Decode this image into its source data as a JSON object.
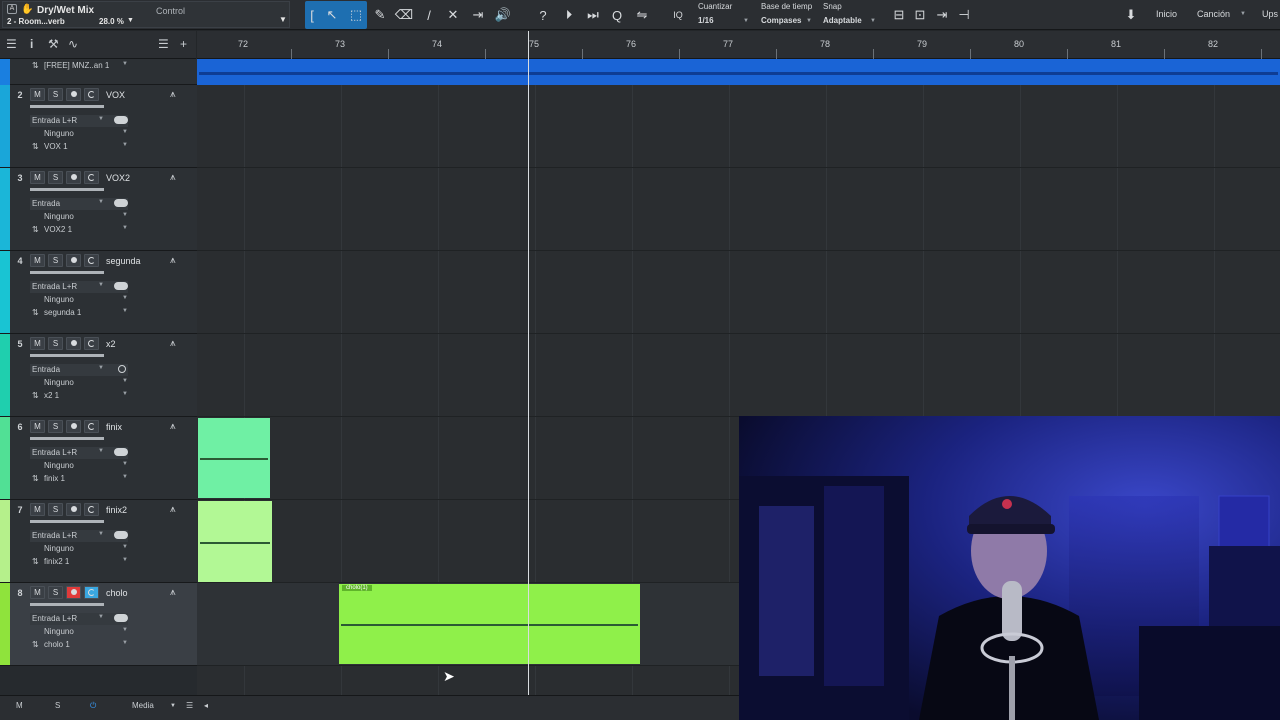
{
  "plugin": {
    "title": "Dry/Wet Mix",
    "preset": "2 - Room...verb",
    "percent": "28.0 %",
    "control": "Control"
  },
  "toolbar": {
    "quantize_label": "Cuantizar",
    "quantize_value": "1/16",
    "timebase_label": "Base de tiemp",
    "timebase_value": "Compases",
    "snap_label": "Snap",
    "snap_value": "Adaptable",
    "start": "Inicio",
    "song": "Canción",
    "upgrade": "Ups"
  },
  "ruler": {
    "bars": [
      "72",
      "73",
      "74",
      "75",
      "76",
      "77",
      "78",
      "79",
      "80",
      "81",
      "82"
    ]
  },
  "first_track": {
    "name": "[FREE] MNZ..an 1"
  },
  "tracks": [
    {
      "num": "2",
      "name": "VOX",
      "input": "Entrada L+R",
      "output": "Ninguno",
      "playlist": "VOX 1",
      "color": "#1aa6d9"
    },
    {
      "num": "3",
      "name": "VOX2",
      "input": "Entrada",
      "output": "Ninguno",
      "playlist": "VOX2 1",
      "color": "#1bb6d8"
    },
    {
      "num": "4",
      "name": "segunda",
      "input": "Entrada L+R",
      "output": "Ninguno",
      "playlist": "segunda 1",
      "color": "#19c4d3"
    },
    {
      "num": "5",
      "name": "x2",
      "input": "Entrada",
      "output": "Ninguno",
      "playlist": "x2 1",
      "color": "#1fcfae"
    },
    {
      "num": "6",
      "name": "finix",
      "input": "Entrada L+R",
      "output": "Ninguno",
      "playlist": "finix 1",
      "color": "#51e095"
    },
    {
      "num": "7",
      "name": "finix2",
      "input": "Entrada L+R",
      "output": "Ninguno",
      "playlist": "finix2 1",
      "color": "#b5f08b"
    },
    {
      "num": "8",
      "name": "cholo",
      "input": "Entrada L+R",
      "output": "Ninguno",
      "playlist": "cholo 1",
      "color": "#8fe33c"
    }
  ],
  "events": {
    "cholo_label": "cholo(1)"
  },
  "bottom": {
    "m": "M",
    "s": "S",
    "media": "Media"
  },
  "colors": {
    "accent": "#2e82c7",
    "first_track_audio": "#1a64d6",
    "cholo_event": "#8ff04a",
    "finix_event": "#6ff0a4",
    "finix2_event": "#b2f895"
  }
}
